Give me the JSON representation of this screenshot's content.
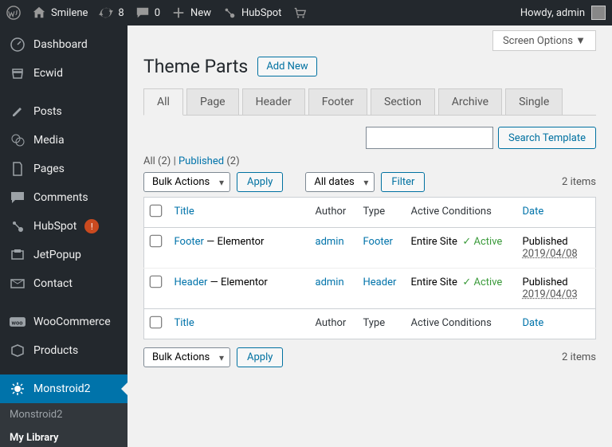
{
  "adminbar": {
    "site_name": "Smilene",
    "updates_count": "8",
    "comments_count": "0",
    "new_label": "New",
    "hubspot_label": "HubSpot",
    "howdy": "Howdy, admin"
  },
  "sidebar": {
    "items": [
      {
        "label": "Dashboard"
      },
      {
        "label": "Ecwid"
      },
      {
        "label": "Posts"
      },
      {
        "label": "Media"
      },
      {
        "label": "Pages"
      },
      {
        "label": "Comments"
      },
      {
        "label": "HubSpot",
        "badge": "!"
      },
      {
        "label": "JetPopup"
      },
      {
        "label": "Contact"
      },
      {
        "label": "WooCommerce"
      },
      {
        "label": "Products"
      },
      {
        "label": "Monstroid2"
      }
    ],
    "submenu": [
      {
        "label": "Monstroid2"
      },
      {
        "label": "My Library"
      }
    ]
  },
  "screen_options": "Screen Options",
  "page": {
    "title": "Theme Parts",
    "add_new": "Add New"
  },
  "tabs": [
    "All",
    "Page",
    "Header",
    "Footer",
    "Section",
    "Archive",
    "Single"
  ],
  "subsub": {
    "all_label": "All",
    "all_count": "(2)",
    "sep": " | ",
    "published_label": "Published",
    "published_count": "(2)"
  },
  "search": {
    "button": "Search Template"
  },
  "bulk": {
    "label": "Bulk Actions",
    "apply": "Apply"
  },
  "dates": {
    "label": "All dates",
    "filter": "Filter"
  },
  "items_count": "2 items",
  "columns": {
    "title": "Title",
    "author": "Author",
    "type": "Type",
    "conditions": "Active Conditions",
    "date": "Date"
  },
  "rows": [
    {
      "title": "Footer",
      "suffix": " — Elementor",
      "author": "admin",
      "type": "Footer",
      "scope": "Entire Site",
      "status": "✓ Active",
      "date_label": "Published",
      "date_stamp": "2019/04/08"
    },
    {
      "title": "Header",
      "suffix": " — Elementor",
      "author": "admin",
      "type": "Header",
      "scope": "Entire Site",
      "status": "✓ Active",
      "date_label": "Published",
      "date_stamp": "2019/04/03"
    }
  ]
}
